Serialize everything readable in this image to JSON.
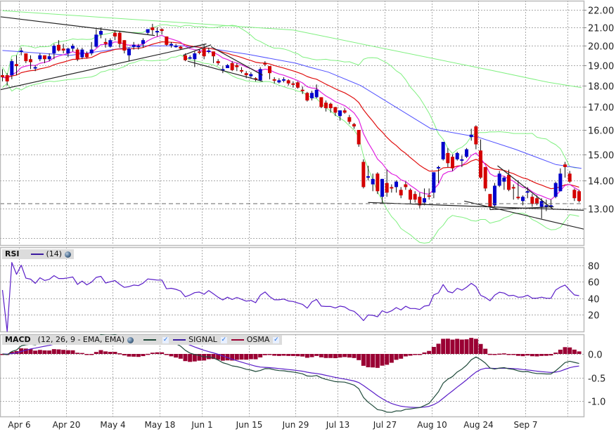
{
  "chart_data": {
    "type": "candlestick",
    "price_axis": {
      "scale": "log",
      "ticks": [
        "22.00",
        "21.00",
        "20.00",
        "19.00",
        "18.00",
        "17.00",
        "16.00",
        "15.00",
        "14.00",
        "13.00"
      ],
      "tick_values": [
        22,
        21,
        20,
        19,
        18,
        17,
        16,
        15,
        14,
        13
      ],
      "range": [
        11.8,
        22.5
      ]
    },
    "x_axis": {
      "labels": [
        "Apr 6",
        "Apr 20",
        "May 4",
        "May 18",
        "Jun 1",
        "Jun 15",
        "Jun 29",
        "Jul 13",
        "Jul 27",
        "Aug 10",
        "Aug 24",
        "Sep 7",
        ""
      ],
      "grid_index": [
        3.5,
        13.5,
        23.5,
        33.5,
        42.5,
        52.5,
        62.5,
        71.5,
        81.5,
        91.5,
        101.5,
        111.5,
        120.5
      ]
    },
    "candles": [
      [
        18.5,
        18.8,
        18.2,
        18.4
      ],
      [
        18.5,
        18.6,
        18.0,
        18.2
      ],
      [
        18.5,
        19.3,
        18.3,
        19.2
      ],
      [
        19.05,
        19.5,
        18.5,
        18.95
      ],
      [
        19.7,
        19.9,
        19.5,
        19.75
      ],
      [
        19.6,
        19.6,
        19.1,
        19.2
      ],
      [
        19.3,
        19.5,
        18.8,
        19.15
      ],
      [
        18.85,
        19.0,
        18.7,
        18.9
      ],
      [
        19.3,
        19.6,
        19.2,
        19.5
      ],
      [
        19.5,
        19.5,
        19.1,
        19.3
      ],
      [
        19.3,
        19.6,
        19.2,
        19.45
      ],
      [
        19.6,
        20.1,
        19.3,
        20.0
      ],
      [
        20.05,
        20.3,
        19.7,
        19.75
      ],
      [
        19.85,
        20.1,
        19.6,
        19.75
      ],
      [
        19.6,
        19.9,
        19.4,
        19.85
      ],
      [
        19.85,
        20.1,
        19.7,
        20.0
      ],
      [
        19.8,
        19.9,
        19.2,
        19.3
      ],
      [
        19.4,
        19.9,
        19.3,
        19.8
      ],
      [
        19.6,
        19.7,
        19.35,
        19.4
      ],
      [
        19.6,
        20.2,
        19.5,
        19.8
      ],
      [
        19.95,
        20.9,
        19.9,
        20.6
      ],
      [
        20.6,
        21.0,
        20.4,
        20.8
      ],
      [
        20.2,
        20.4,
        19.9,
        20.1
      ],
      [
        19.95,
        20.4,
        19.9,
        20.3
      ],
      [
        20.7,
        20.8,
        20.3,
        20.5
      ],
      [
        20.7,
        20.8,
        19.9,
        20.1
      ],
      [
        20.3,
        20.3,
        19.6,
        19.75
      ],
      [
        19.5,
        19.9,
        19.2,
        19.85
      ],
      [
        19.95,
        20.2,
        19.8,
        20.05
      ],
      [
        19.95,
        20.1,
        19.8,
        20.0
      ],
      [
        20.1,
        20.4,
        19.9,
        20.3
      ],
      [
        20.7,
        20.9,
        20.6,
        20.9
      ],
      [
        21.0,
        21.2,
        20.6,
        20.85
      ],
      [
        20.75,
        21.0,
        20.5,
        20.8
      ],
      [
        20.9,
        20.95,
        20.6,
        20.8
      ],
      [
        20.5,
        20.5,
        20.0,
        20.05
      ],
      [
        20.05,
        20.2,
        19.9,
        20.1
      ],
      [
        19.98,
        20.1,
        19.9,
        20.0
      ],
      [
        19.95,
        20.0,
        19.8,
        19.85
      ],
      [
        19.5,
        19.6,
        19.2,
        19.25
      ],
      [
        19.35,
        19.5,
        19.3,
        19.4
      ],
      [
        19.3,
        19.7,
        18.9,
        19.6
      ],
      [
        19.7,
        19.8,
        19.55,
        19.65
      ],
      [
        19.85,
        20.1,
        19.3,
        19.45
      ],
      [
        19.7,
        19.9,
        19.6,
        19.75
      ],
      [
        19.7,
        19.7,
        19.1,
        19.45
      ],
      [
        19.2,
        19.3,
        19.0,
        19.1
      ],
      [
        18.75,
        18.95,
        18.6,
        18.8
      ],
      [
        18.85,
        19.05,
        18.85,
        19.0
      ],
      [
        19.1,
        19.2,
        18.7,
        18.75
      ],
      [
        19.0,
        19.1,
        18.7,
        18.9
      ],
      [
        18.75,
        18.9,
        18.6,
        18.7
      ],
      [
        18.6,
        18.7,
        18.35,
        18.5
      ],
      [
        18.45,
        18.65,
        18.35,
        18.55
      ],
      [
        18.35,
        18.4,
        18.2,
        18.3
      ],
      [
        18.25,
        18.9,
        18.2,
        18.8
      ],
      [
        19.1,
        19.2,
        18.95,
        19.05
      ],
      [
        18.95,
        18.95,
        18.3,
        18.6
      ],
      [
        18.3,
        18.4,
        18.1,
        18.25
      ],
      [
        18.15,
        18.35,
        18.1,
        18.25
      ],
      [
        18.25,
        18.4,
        18.15,
        18.3
      ],
      [
        18.25,
        18.3,
        18.0,
        18.1
      ],
      [
        18.1,
        18.2,
        17.9,
        18.05
      ],
      [
        18.15,
        18.2,
        17.85,
        17.9
      ],
      [
        17.8,
        17.95,
        17.6,
        17.75
      ],
      [
        17.65,
        17.7,
        17.25,
        17.3
      ],
      [
        17.4,
        17.75,
        17.3,
        17.65
      ],
      [
        17.45,
        18.05,
        17.4,
        17.8
      ],
      [
        17.45,
        17.45,
        16.95,
        17.0
      ],
      [
        17.2,
        17.3,
        16.8,
        16.95
      ],
      [
        17.15,
        17.2,
        16.75,
        16.95
      ],
      [
        17.0,
        17.0,
        16.6,
        16.75
      ],
      [
        16.6,
        16.85,
        16.4,
        16.85
      ],
      [
        16.85,
        16.95,
        16.7,
        16.75
      ],
      [
        16.55,
        16.65,
        16.25,
        16.35
      ],
      [
        16.25,
        16.3,
        16.05,
        16.15
      ],
      [
        16.0,
        16.0,
        15.3,
        15.4
      ],
      [
        14.7,
        14.8,
        13.7,
        13.75
      ],
      [
        14.1,
        14.55,
        14.0,
        14.15
      ],
      [
        13.85,
        14.25,
        13.6,
        14.05
      ],
      [
        14.25,
        14.3,
        13.5,
        13.6
      ],
      [
        13.4,
        14.05,
        13.15,
        14.05
      ],
      [
        13.9,
        14.4,
        13.4,
        13.55
      ],
      [
        13.75,
        13.85,
        13.55,
        13.7
      ],
      [
        13.75,
        14.0,
        13.55,
        13.95
      ],
      [
        13.65,
        13.75,
        13.35,
        13.45
      ],
      [
        13.85,
        13.95,
        13.65,
        13.75
      ],
      [
        13.65,
        13.7,
        13.15,
        13.3
      ],
      [
        13.5,
        13.6,
        13.2,
        13.3
      ],
      [
        13.4,
        13.55,
        13.0,
        13.1
      ],
      [
        13.2,
        13.7,
        13.1,
        13.35
      ],
      [
        13.45,
        13.7,
        13.3,
        13.4
      ],
      [
        13.55,
        14.3,
        13.35,
        14.3
      ],
      [
        14.45,
        14.55,
        13.9,
        14.5
      ],
      [
        14.8,
        15.5,
        14.75,
        15.5
      ],
      [
        15.05,
        15.25,
        14.5,
        14.65
      ],
      [
        14.9,
        15.0,
        14.35,
        14.45
      ],
      [
        14.8,
        15.1,
        14.75,
        15.05
      ],
      [
        14.75,
        14.95,
        14.5,
        14.8
      ],
      [
        14.9,
        15.25,
        14.85,
        15.2
      ],
      [
        15.7,
        16.05,
        15.55,
        15.8
      ],
      [
        16.15,
        16.2,
        15.2,
        15.4
      ],
      [
        15.15,
        15.6,
        14.05,
        14.1
      ],
      [
        14.5,
        14.5,
        13.6,
        13.7
      ],
      [
        13.5,
        13.5,
        12.95,
        13.05
      ],
      [
        13.1,
        13.9,
        13.05,
        13.8
      ],
      [
        13.8,
        14.35,
        13.75,
        14.25
      ],
      [
        13.95,
        14.15,
        13.65,
        14.1
      ],
      [
        14.2,
        14.4,
        13.6,
        13.65
      ],
      [
        13.75,
        13.85,
        13.3,
        13.7
      ],
      [
        13.4,
        14.0,
        13.3,
        13.37
      ],
      [
        13.25,
        13.45,
        13.1,
        13.4
      ],
      [
        13.55,
        13.75,
        13.35,
        13.6
      ],
      [
        13.4,
        13.5,
        13.05,
        13.15
      ],
      [
        13.35,
        13.45,
        13.1,
        13.15
      ],
      [
        13.05,
        13.35,
        12.65,
        13.25
      ],
      [
        13.05,
        13.3,
        12.9,
        13.1
      ],
      [
        13.05,
        13.3,
        13.0,
        13.1
      ],
      [
        13.4,
        13.95,
        13.35,
        13.9
      ],
      [
        13.6,
        14.45,
        13.6,
        14.25
      ],
      [
        14.6,
        14.7,
        14.1,
        14.5
      ],
      [
        14.25,
        14.35,
        13.9,
        13.95
      ],
      [
        13.65,
        13.7,
        13.25,
        13.35
      ],
      [
        13.6,
        13.65,
        13.2,
        13.25
      ]
    ],
    "overlays": {
      "ma_long_points": [
        [
          0,
          21.95
        ],
        [
          42,
          21.2
        ],
        [
          62,
          20.85
        ],
        [
          104,
          18.75
        ],
        [
          116.5,
          18.15
        ],
        [
          123.5,
          17.9
        ]
      ],
      "ma_mid_points": [
        [
          0,
          19.75
        ],
        [
          14.5,
          19.5
        ],
        [
          29.5,
          20.0
        ],
        [
          38.5,
          20.0
        ],
        [
          44.5,
          19.85
        ],
        [
          52.4,
          19.55
        ],
        [
          62.5,
          19.1
        ],
        [
          65.5,
          18.9
        ],
        [
          69.5,
          18.65
        ],
        [
          76.4,
          18.0
        ],
        [
          91.4,
          16.05
        ],
        [
          101.4,
          15.7
        ],
        [
          109.4,
          15.2
        ],
        [
          118,
          14.6
        ],
        [
          123.5,
          14.45
        ]
      ],
      "ema_fast_period": 8,
      "ema_slow_period": 20,
      "bollinger": {
        "period": 20,
        "stddev": 2
      },
      "reference_price": 13.16,
      "trendlines": [
        [
          [
            -0.5,
            21.6
          ],
          [
            32.5,
            20.55
          ]
        ],
        [
          [
            -0.5,
            17.8
          ],
          [
            43.5,
            20.1
          ]
        ],
        [
          [
            38.5,
            19.5
          ],
          [
            44.5,
            20.05
          ]
        ],
        [
          [
            39.5,
            19.2
          ],
          [
            55.5,
            18.2
          ]
        ],
        [
          [
            44.5,
            19.95
          ],
          [
            55.5,
            18.5
          ]
        ],
        [
          [
            78,
            13.2
          ],
          [
            124,
            12.93
          ]
        ],
        [
          [
            98.5,
            13.25
          ],
          [
            124,
            12.3
          ]
        ],
        [
          [
            105.6,
            14.55
          ],
          [
            117.6,
            12.95
          ]
        ],
        [
          [
            104,
            12.95
          ],
          [
            117.6,
            13.05
          ]
        ]
      ]
    },
    "rsi": {
      "label": "RSI",
      "params": "(14)",
      "period": 14,
      "ticks": [
        "80",
        "60",
        "40",
        "20"
      ],
      "tick_values": [
        80,
        60,
        40,
        20
      ],
      "range": [
        0,
        100
      ]
    },
    "macd": {
      "label": "MACD",
      "params": "(12, 26, 9 - EMA, EMA)",
      "fast": 12,
      "slow": 26,
      "signal": 9,
      "signal_label": "SIGNAL",
      "osma_label": "OSMA",
      "ticks": [
        "0.0",
        "-0.5",
        "-1.0"
      ],
      "tick_values": [
        0,
        -0.5,
        -1.0
      ],
      "range": [
        -1.33,
        0.42
      ]
    },
    "colors": {
      "up": "#0000cc",
      "down": "#d40000",
      "ma_long": "#80f080",
      "ma_mid": "#5050ff",
      "ema_slow": "#e01010",
      "ema_fast": "#e020e0",
      "bands": "#80f080",
      "rsi": "#5a1ec8",
      "macd": "#1f4a3a",
      "signal": "#5a1ec8",
      "osma": "#9a0033",
      "grid": "#aaaaaa",
      "frame": "#bbbbbb"
    }
  }
}
